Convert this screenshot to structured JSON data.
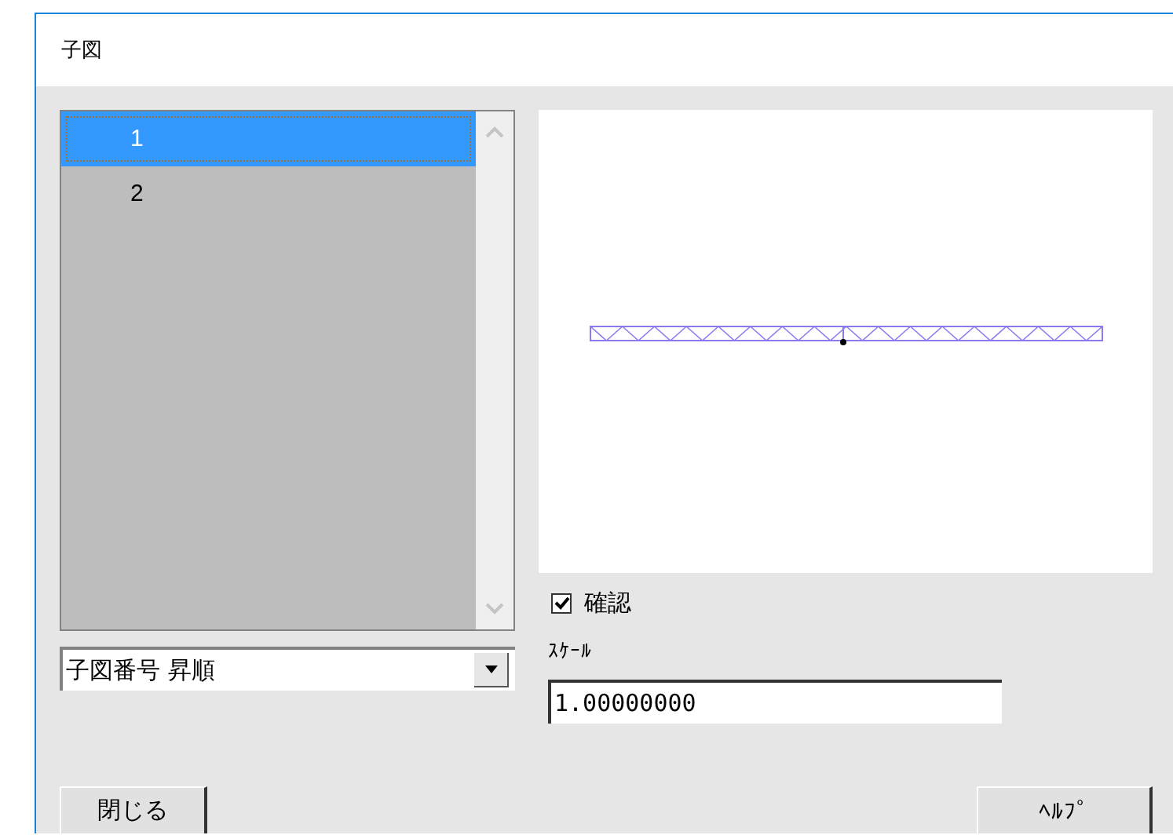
{
  "window": {
    "title": "子図"
  },
  "list": {
    "items": [
      {
        "label": "1",
        "selected": true
      },
      {
        "label": "2",
        "selected": false
      }
    ]
  },
  "sort": {
    "value": "子図番号 昇順"
  },
  "preview": {
    "kind": "truss"
  },
  "confirm": {
    "label": "確認",
    "checked": true
  },
  "scale": {
    "label": "ｽｹｰﾙ",
    "value": "1.00000000"
  },
  "buttons": [
    {
      "label": "閉じる"
    },
    {
      "label": "ﾍﾙﾌﾟ"
    }
  ]
}
